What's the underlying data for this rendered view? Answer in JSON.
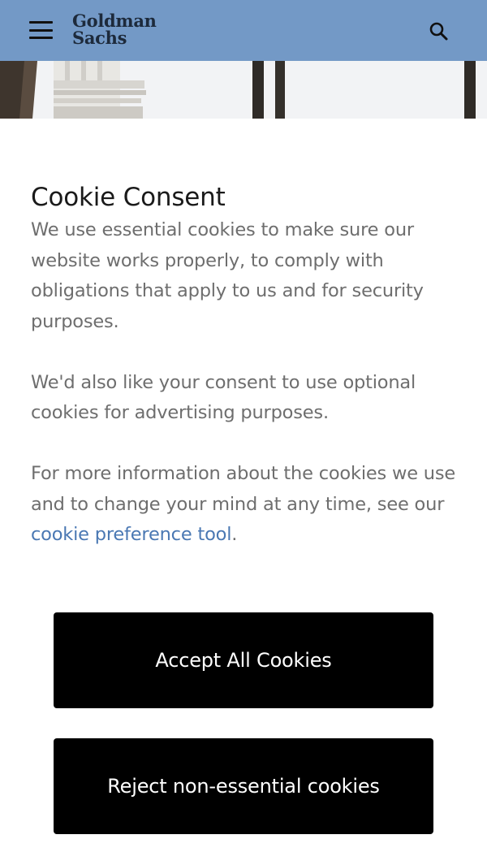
{
  "header": {
    "logo_line1": "Goldman",
    "logo_line2": "Sachs",
    "background_color": "#7399c6",
    "menu_icon": "hamburger-menu-icon",
    "search_icon": "search-icon"
  },
  "consent": {
    "title": "Cookie Consent",
    "paragraph1": "We use essential cookies to make sure our website works properly, to comply with obligations that apply to us and for security purposes.",
    "paragraph2": "We'd also like your consent to use optional cookies for advertising purposes.",
    "paragraph3_prefix": "For more information about the cookies we use and to change your mind at any time, see our ",
    "paragraph3_link": "cookie preference tool",
    "paragraph3_suffix": ".",
    "link_color": "#4a78b3",
    "accept_label": "Accept All Cookies",
    "reject_label": "Reject non-essential cookies"
  }
}
